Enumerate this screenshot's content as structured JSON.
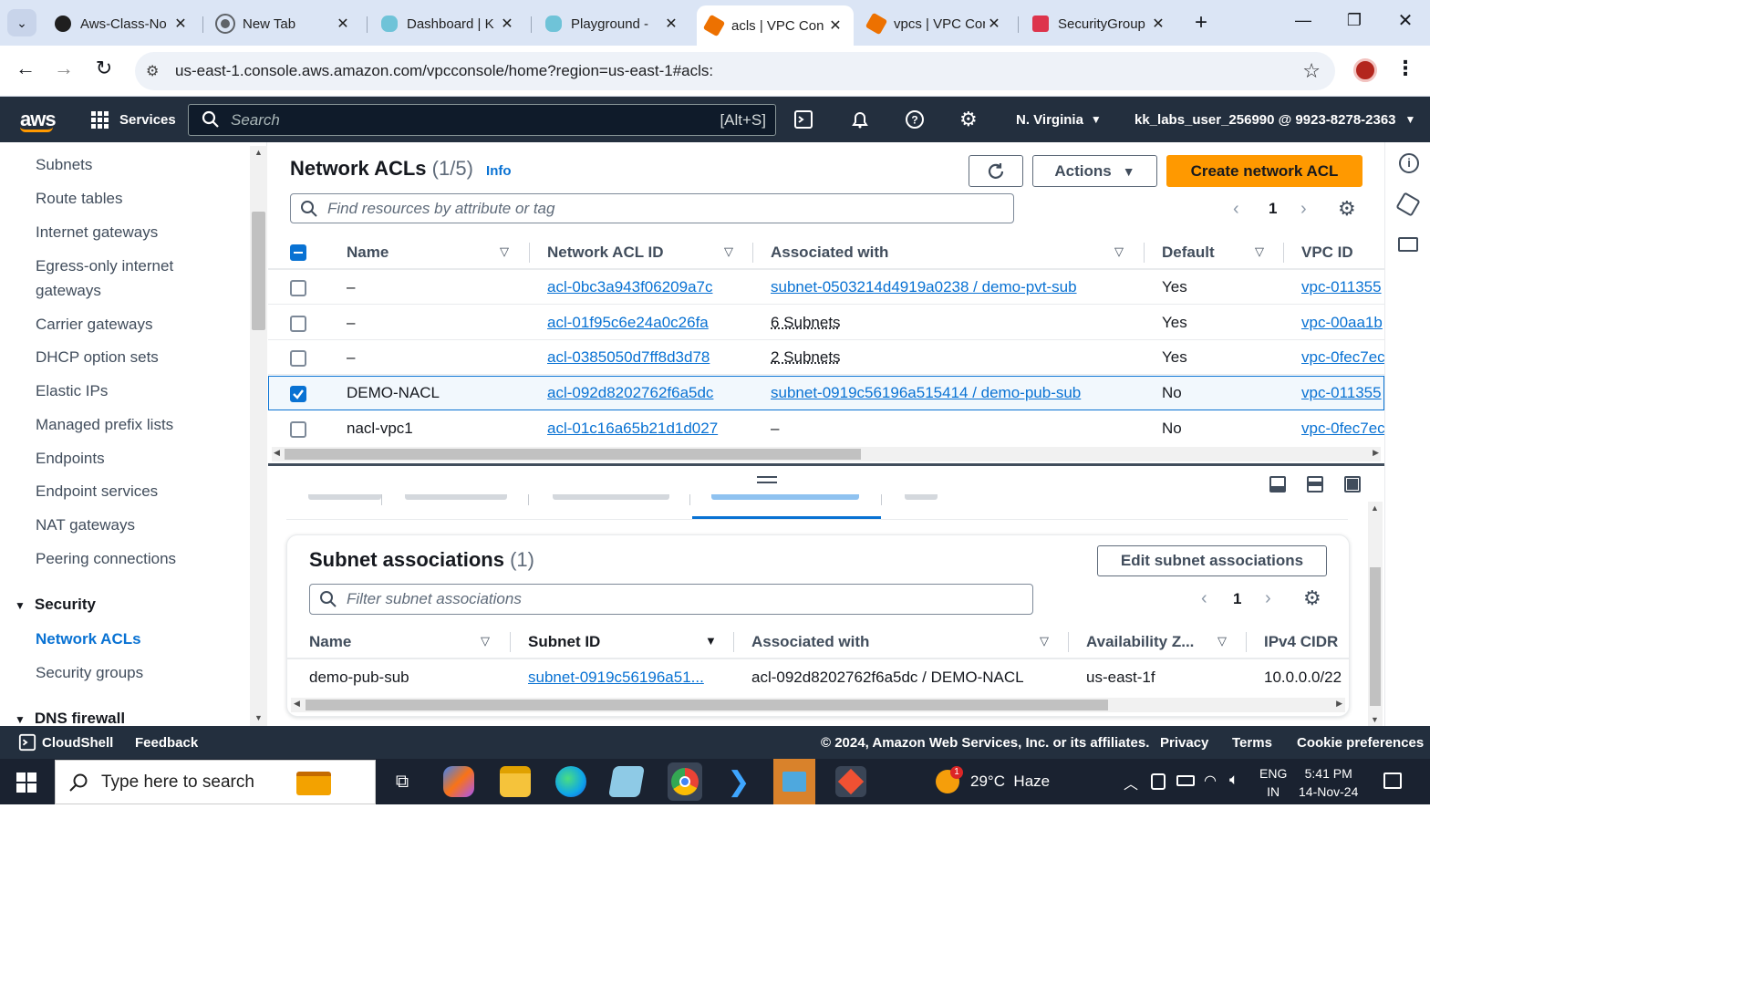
{
  "browser": {
    "tabs": [
      {
        "title": "Aws-Class-No",
        "icon": "github-icon"
      },
      {
        "title": "New Tab",
        "icon": "chrome-icon"
      },
      {
        "title": "Dashboard | K",
        "icon": "kodekloud-icon"
      },
      {
        "title": "Playground - ",
        "icon": "kodekloud-icon"
      },
      {
        "title": "acls | VPC Con",
        "icon": "aws-vpc-icon"
      },
      {
        "title": "vpcs | VPC Con",
        "icon": "aws-vpc-icon"
      },
      {
        "title": "SecurityGroup",
        "icon": "aws-icon"
      }
    ],
    "url": "us-east-1.console.aws.amazon.com/vpcconsole/home?region=us-east-1#acls:"
  },
  "awsnav": {
    "logo": "aws",
    "services": "Services",
    "search_placeholder": "Search",
    "search_shortcut": "[Alt+S]",
    "region": "N. Virginia",
    "account": "kk_labs_user_256990 @ 9923-8278-2363"
  },
  "sidebar": {
    "items": [
      "Subnets",
      "Route tables",
      "Internet gateways",
      "Egress-only internet",
      "gateways",
      "Carrier gateways",
      "DHCP option sets",
      "Elastic IPs",
      "Managed prefix lists",
      "Endpoints",
      "Endpoint services",
      "NAT gateways",
      "Peering connections"
    ],
    "security_header": "Security",
    "security_items": [
      "Network ACLs",
      "Security groups"
    ],
    "dns_header": "DNS firewall"
  },
  "nacl": {
    "title": "Network ACLs",
    "count": "(1/5)",
    "info": "Info",
    "actions": "Actions",
    "create": "Create network ACL",
    "filter_placeholder": "Find resources by attribute or tag",
    "page": "1",
    "headers": [
      "Name",
      "Network ACL ID",
      "Associated with",
      "Default",
      "VPC ID"
    ],
    "rows": [
      {
        "name": "–",
        "id": "acl-0bc3a943f06209a7c",
        "assoc": "subnet-0503214d4919a0238 / demo-pvt-sub",
        "default": "Yes",
        "vpc": "vpc-011355"
      },
      {
        "name": "–",
        "id": "acl-01f95c6e24a0c26fa",
        "assoc": "6 Subnets",
        "default": "Yes",
        "vpc": "vpc-00aa1b"
      },
      {
        "name": "–",
        "id": "acl-0385050d7ff8d3d78",
        "assoc": "2 Subnets",
        "default": "Yes",
        "vpc": "vpc-0fec7ec"
      },
      {
        "name": "DEMO-NACL",
        "id": "acl-092d8202762f6a5dc",
        "assoc": "subnet-0919c56196a515414 / demo-pub-sub",
        "default": "No",
        "vpc": "vpc-011355"
      },
      {
        "name": "nacl-vpc1",
        "id": "acl-01c16a65b21d1d027",
        "assoc": "–",
        "default": "No",
        "vpc": "vpc-0fec7ec"
      }
    ]
  },
  "details": {
    "title": "Subnet associations",
    "count": "(1)",
    "edit": "Edit subnet associations",
    "filter_placeholder": "Filter subnet associations",
    "page": "1",
    "headers": [
      "Name",
      "Subnet ID",
      "Associated with",
      "Availability Z...",
      "IPv4 CIDR"
    ],
    "rows": [
      {
        "name": "demo-pub-sub",
        "subnet": "subnet-0919c56196a51...",
        "assoc": "acl-092d8202762f6a5dc / DEMO-NACL",
        "az": "us-east-1f",
        "cidr": "10.0.0.0/22"
      }
    ]
  },
  "footer": {
    "cloudshell": "CloudShell",
    "feedback": "Feedback",
    "copyright": "© 2024, Amazon Web Services, Inc. or its affiliates.",
    "privacy": "Privacy",
    "terms": "Terms",
    "cookies": "Cookie preferences"
  },
  "taskbar": {
    "search_placeholder": "Type here to search",
    "weather": "29°C  Haze",
    "lang1": "ENG",
    "lang2": "IN",
    "time": "5:41 PM",
    "date": "14-Nov-24",
    "weather_badge": "1"
  },
  "colors": {
    "aws_nav": "#232f3e",
    "primary": "#ff9900",
    "link": "#0972d3",
    "selected_row": "#f2f8fd"
  }
}
